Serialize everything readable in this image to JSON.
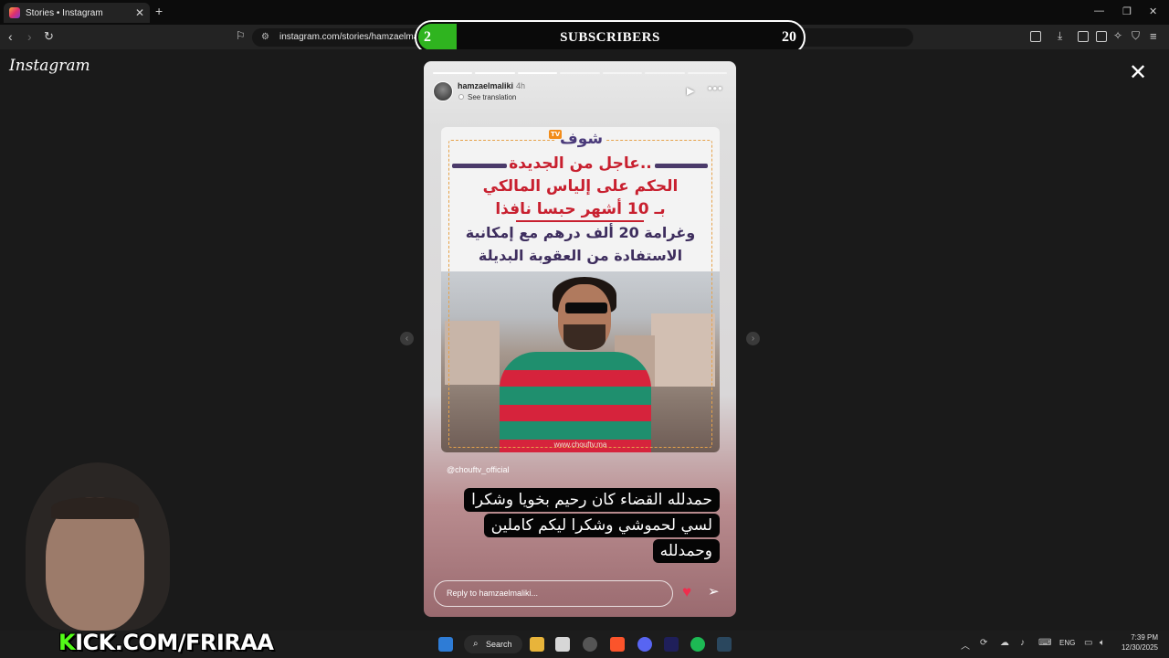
{
  "browser": {
    "tab_title": "Stories • Instagram",
    "url": "instagram.com/stories/hamzaelmaliki/3801251592806304/"
  },
  "overlay": {
    "subscribers_current": "2",
    "subscribers_label": "SUBSCRIBERS",
    "subscribers_goal": "20",
    "subscribers_progress": 0.1
  },
  "instagram": {
    "logo": "Instagram",
    "story": {
      "username": "hamzaelmaliki",
      "time_ago": "4h",
      "see_translation": "See translation",
      "segments_total": 7,
      "segments_done": 3,
      "news": {
        "brand": "شوف",
        "brand_badge": "TV",
        "line1": "عاجل من الجديدة..",
        "line2": "الحكم على إلياس المالكي",
        "line3": "بـ 10 أشهر حبسا نافذا",
        "line4": "وغرامة 20 ألف درهم مع إمكانية",
        "line5": "الاستفادة من العقوبة البديلة",
        "site": "www.chouftv.ma"
      },
      "mention": "@chouftv_official",
      "caption": "حمدلله القضاء كان رحيم بخويا وشكرا لسي لحموشي وشكرا ليكم كاملين وحمدلله",
      "reply_placeholder": "Reply to hamzaelmaliki..."
    }
  },
  "stream": {
    "watermark_brand": "K",
    "watermark_text": "KICK.COM/FRIRAA"
  },
  "taskbar": {
    "search_label": "Search",
    "language": "ENG",
    "time": "7:39 PM",
    "date": "12/30/2025"
  },
  "colors": {
    "subscribers_fill": "#2fb41f",
    "kick_green": "#53fc18",
    "heart": "#ef2d4d",
    "news_red": "#c8202f"
  }
}
